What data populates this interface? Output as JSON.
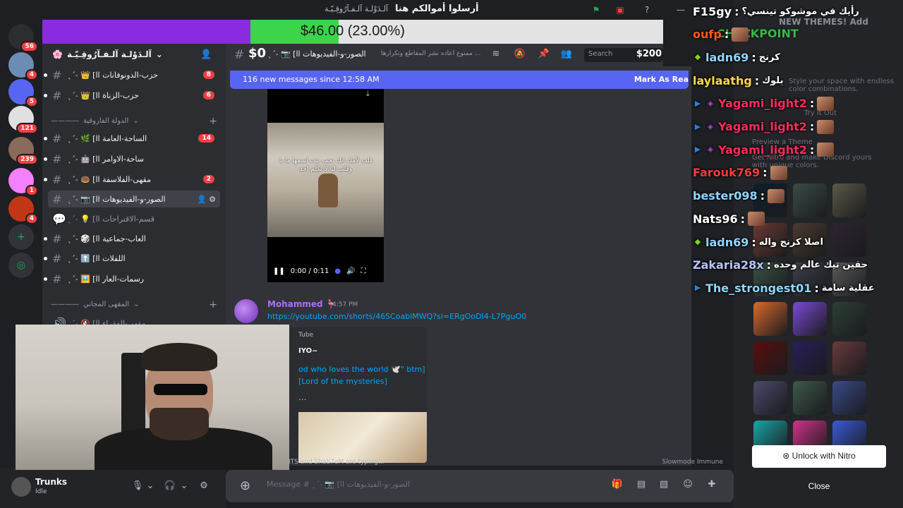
{
  "titlebar": {
    "title": "أرسلوا أموالكم هنا",
    "subtitle": "آلـدَوْلـة آلـفـآرُوقِـيّـة"
  },
  "rail": {
    "items": [
      {
        "name": "discord-home",
        "badge": "56",
        "color": "#2b2d31"
      },
      {
        "name": "dm-avatar",
        "badge": "4",
        "color": "#6d8cb4"
      },
      {
        "name": "discord-server",
        "badge": "5",
        "color": "#5865f2"
      },
      {
        "name": "server-red",
        "badge": "121",
        "color": "#e0e0e0"
      },
      {
        "name": "server-person",
        "badge": "239",
        "color": "#8a6a5a"
      },
      {
        "name": "server-pink",
        "badge": "1",
        "color": "#f47fff"
      },
      {
        "name": "server-orange",
        "badge": "4",
        "color": "#c23616"
      }
    ]
  },
  "progress": {
    "amount_text": "$46.00 (23.00%)",
    "current_fraction": 0.23,
    "previous_fraction": 0.335
  },
  "sidebar": {
    "server_name": "آلـدَوْلـة آلـفـآرُوقِـيّـة",
    "channels_top": [
      {
        "label": "ˎˊ˗ 👑 [حزب-الدونوفانات اا",
        "badge": "8"
      },
      {
        "label": "ˎˊ˗ 👑 [حزب-الزناة اا",
        "badge": "6"
      }
    ],
    "category_1": "الدولة الفاروقية",
    "channels_mid": [
      {
        "label": "ˎˊ˗ 🌿 [الساحة-العامة اا",
        "badge": "14"
      },
      {
        "label": "ˎˊ˗ 🤖 [ساحة-الاوامر اا",
        "badge": ""
      },
      {
        "label": "ˎˊ˗ 🍩 [مقهى-الفلاسفة اا",
        "badge": "2"
      },
      {
        "label": "ˎˊ˗ 📷 [الصور-و-الفيديوهات اا",
        "badge": ""
      },
      {
        "label": "ˎˊ˗ 💡 [قسم-الاقتراحات اا",
        "badge": ""
      },
      {
        "label": "ˎˊ˗ 🎲 [العاب-جماعية اا",
        "badge": ""
      },
      {
        "label": "ˎˊ˗ ⬆️ [اللفلات اا",
        "badge": ""
      },
      {
        "label": "ˎˊ˗ 🖼️ [رسمات-العار اا",
        "badge": ""
      }
    ],
    "category_2": "المقهى المجاني",
    "channel_voice": "ˎˊ˗ 🔇 [مقهى-الفقراء اا"
  },
  "header": {
    "goal": "$0",
    "channel": "ˎˊ˗ 📷 [الصور-و-الفيديوهات اا",
    "topic": "ممنوع اعاده نشر المقاطع وتكرارها ...",
    "search_placeholder": "Search",
    "search_amount": "$200"
  },
  "chat": {
    "new_messages": "116 new messages since 12:58 AM",
    "mark_read": "Mark As Rea",
    "video": {
      "caption": "قلت لأمك انك تحب بنت اسمها ما يا وقلب ليا لا تكلم احد",
      "time": "0:00 / 0:11"
    },
    "message": {
      "author": "Mohammed 🦩",
      "time": "4:57 PM",
      "link": "https://youtube.com/shorts/46SCoablMWQ?si=ERgOoDI4-L7PguO0"
    },
    "embed": {
      "provider": "Tube",
      "author": "IYO~",
      "title": "od who loves the world 🕊️\" btm] [Lord of the mysteries]",
      "extra": "..."
    },
    "typing": "ITS and Shab7eM are typing...",
    "slowmode": "Slowmode Immune"
  },
  "composer": {
    "placeholder": "Message # ˎˊ˗ 📷 [الصور-و-الفيديوهات اا"
  },
  "user": {
    "name": "Trunks",
    "status": "Idle"
  },
  "nitro": {
    "new_themes": "NEW THEMES! Add",
    "style": "Style your space with endless color combinations.",
    "try": "Try It Out",
    "preview": "Preview a Theme",
    "get": "Get Nitro and make Discord yours with unique colors.",
    "unlock": "Unlock with Nitro",
    "close": "Close",
    "swatches": [
      "#0f1e2a",
      "#3a4d46",
      "#5c5a46",
      "#6a3a30",
      "#4b3a2e",
      "#2d2530",
      "#3a5245",
      "#3d3f4a",
      "#5a5a5a",
      "#d96a2a",
      "#7b4ad8",
      "#2c3f35",
      "#5a0d0d",
      "#2a1d5a",
      "#6a3b3b",
      "#4a4a6a",
      "#3d5a4a",
      "#3a4a8a",
      "#1aa6a6",
      "#d0348a",
      "#3a5ad8"
    ]
  },
  "overlay": {
    "lines": [
      {
        "user": "F15gy",
        "color": "#ffffff",
        "msg": "رأيك في موشوكو تينسي؟",
        "badges": [],
        "emote": false
      },
      {
        "user": "oufp",
        "color": "#ff5a1f",
        "msg": "",
        "badges": [],
        "emote": true
      },
      {
        "user": "ladn69",
        "color": "#8fd6ff",
        "msg": "كرنج",
        "badges": [
          "diamond"
        ],
        "emote": false
      },
      {
        "user": "laylaathg",
        "color": "#ffd84a",
        "msg": "بلوك",
        "badges": [],
        "emote": false
      },
      {
        "user": "Yagami_light2",
        "color": "#ff2b5e",
        "msg": "",
        "badges": [
          "prime",
          "cube"
        ],
        "emote": true
      },
      {
        "user": "Yagami_light2",
        "color": "#ff2b5e",
        "msg": "",
        "badges": [
          "prime",
          "cube"
        ],
        "emote": true
      },
      {
        "user": "Yagami_light2",
        "color": "#ff2b5e",
        "msg": "",
        "badges": [
          "prime",
          "cube"
        ],
        "emote": true
      },
      {
        "user": "Farouk769",
        "color": "#ff3b3b",
        "msg": "",
        "badges": [],
        "emote": true
      },
      {
        "user": "bester098",
        "color": "#8fd6ff",
        "msg": "",
        "badges": [],
        "emote": true
      },
      {
        "user": "Nats96",
        "color": "#ffffff",
        "msg": "",
        "badges": [],
        "emote": true
      },
      {
        "user": "ladn69",
        "color": "#8fd6ff",
        "msg": "اصلا كرنج واله",
        "badges": [
          "diamond"
        ],
        "emote": false
      },
      {
        "user": "Zakaria28x",
        "color": "#b8c4ff",
        "msg": "حقين تيك عالم وحده",
        "badges": [],
        "emote": false
      },
      {
        "user": "The_strongest01",
        "color": "#8fd6ff",
        "msg": "عقلية سامة",
        "badges": [
          "prime"
        ],
        "emote": false
      }
    ],
    "checkpoint": "CHECKPOINT"
  }
}
